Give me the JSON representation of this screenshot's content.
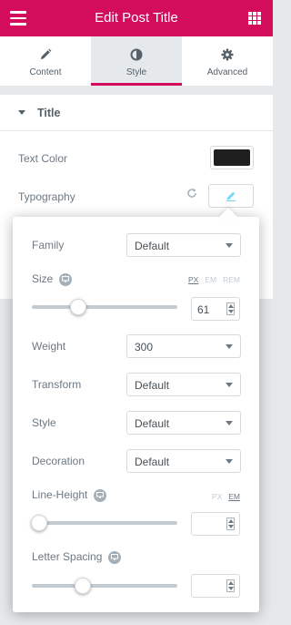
{
  "header": {
    "title": "Edit Post Title",
    "menu_icon": "hamburger-icon",
    "grid_icon": "grid-icon"
  },
  "tabs": [
    {
      "label": "Content",
      "icon": "pencil-icon",
      "active": false
    },
    {
      "label": "Style",
      "icon": "half-circle-icon",
      "active": true
    },
    {
      "label": "Advanced",
      "icon": "gear-icon",
      "active": false
    }
  ],
  "section": {
    "title": "Title",
    "text_color_label": "Text Color",
    "text_color_value": "#1f1f1f",
    "typography_label": "Typography"
  },
  "typography": {
    "family": {
      "label": "Family",
      "value": "Default"
    },
    "size": {
      "label": "Size",
      "units": [
        "PX",
        "EM",
        "REM"
      ],
      "active_unit": "PX",
      "value": "61",
      "slider_fraction": 0.3
    },
    "weight": {
      "label": "Weight",
      "value": "300"
    },
    "transform": {
      "label": "Transform",
      "value": "Default"
    },
    "style": {
      "label": "Style",
      "value": "Default"
    },
    "decoration": {
      "label": "Decoration",
      "value": "Default"
    },
    "line_height": {
      "label": "Line-Height",
      "units": [
        "PX",
        "EM"
      ],
      "active_unit": "EM",
      "value": "",
      "slider_fraction": 0.0
    },
    "letter_spacing": {
      "label": "Letter Spacing",
      "value": "",
      "slider_fraction": 0.34
    }
  },
  "colors": {
    "accent": "#d30c5c",
    "panel_bg": "#e6e9ec"
  }
}
